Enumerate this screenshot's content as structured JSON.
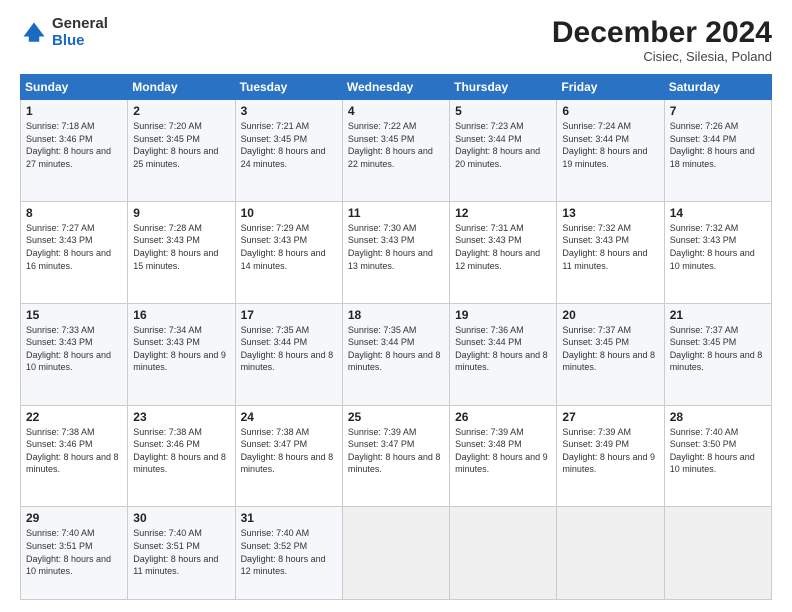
{
  "logo": {
    "general": "General",
    "blue": "Blue"
  },
  "header": {
    "month": "December 2024",
    "location": "Cisiec, Silesia, Poland"
  },
  "weekdays": [
    "Sunday",
    "Monday",
    "Tuesday",
    "Wednesday",
    "Thursday",
    "Friday",
    "Saturday"
  ],
  "weeks": [
    [
      {
        "day": "1",
        "sunrise": "Sunrise: 7:18 AM",
        "sunset": "Sunset: 3:46 PM",
        "daylight": "Daylight: 8 hours and 27 minutes."
      },
      {
        "day": "2",
        "sunrise": "Sunrise: 7:20 AM",
        "sunset": "Sunset: 3:45 PM",
        "daylight": "Daylight: 8 hours and 25 minutes."
      },
      {
        "day": "3",
        "sunrise": "Sunrise: 7:21 AM",
        "sunset": "Sunset: 3:45 PM",
        "daylight": "Daylight: 8 hours and 24 minutes."
      },
      {
        "day": "4",
        "sunrise": "Sunrise: 7:22 AM",
        "sunset": "Sunset: 3:45 PM",
        "daylight": "Daylight: 8 hours and 22 minutes."
      },
      {
        "day": "5",
        "sunrise": "Sunrise: 7:23 AM",
        "sunset": "Sunset: 3:44 PM",
        "daylight": "Daylight: 8 hours and 20 minutes."
      },
      {
        "day": "6",
        "sunrise": "Sunrise: 7:24 AM",
        "sunset": "Sunset: 3:44 PM",
        "daylight": "Daylight: 8 hours and 19 minutes."
      },
      {
        "day": "7",
        "sunrise": "Sunrise: 7:26 AM",
        "sunset": "Sunset: 3:44 PM",
        "daylight": "Daylight: 8 hours and 18 minutes."
      }
    ],
    [
      {
        "day": "8",
        "sunrise": "Sunrise: 7:27 AM",
        "sunset": "Sunset: 3:43 PM",
        "daylight": "Daylight: 8 hours and 16 minutes."
      },
      {
        "day": "9",
        "sunrise": "Sunrise: 7:28 AM",
        "sunset": "Sunset: 3:43 PM",
        "daylight": "Daylight: 8 hours and 15 minutes."
      },
      {
        "day": "10",
        "sunrise": "Sunrise: 7:29 AM",
        "sunset": "Sunset: 3:43 PM",
        "daylight": "Daylight: 8 hours and 14 minutes."
      },
      {
        "day": "11",
        "sunrise": "Sunrise: 7:30 AM",
        "sunset": "Sunset: 3:43 PM",
        "daylight": "Daylight: 8 hours and 13 minutes."
      },
      {
        "day": "12",
        "sunrise": "Sunrise: 7:31 AM",
        "sunset": "Sunset: 3:43 PM",
        "daylight": "Daylight: 8 hours and 12 minutes."
      },
      {
        "day": "13",
        "sunrise": "Sunrise: 7:32 AM",
        "sunset": "Sunset: 3:43 PM",
        "daylight": "Daylight: 8 hours and 11 minutes."
      },
      {
        "day": "14",
        "sunrise": "Sunrise: 7:32 AM",
        "sunset": "Sunset: 3:43 PM",
        "daylight": "Daylight: 8 hours and 10 minutes."
      }
    ],
    [
      {
        "day": "15",
        "sunrise": "Sunrise: 7:33 AM",
        "sunset": "Sunset: 3:43 PM",
        "daylight": "Daylight: 8 hours and 10 minutes."
      },
      {
        "day": "16",
        "sunrise": "Sunrise: 7:34 AM",
        "sunset": "Sunset: 3:43 PM",
        "daylight": "Daylight: 8 hours and 9 minutes."
      },
      {
        "day": "17",
        "sunrise": "Sunrise: 7:35 AM",
        "sunset": "Sunset: 3:44 PM",
        "daylight": "Daylight: 8 hours and 8 minutes."
      },
      {
        "day": "18",
        "sunrise": "Sunrise: 7:35 AM",
        "sunset": "Sunset: 3:44 PM",
        "daylight": "Daylight: 8 hours and 8 minutes."
      },
      {
        "day": "19",
        "sunrise": "Sunrise: 7:36 AM",
        "sunset": "Sunset: 3:44 PM",
        "daylight": "Daylight: 8 hours and 8 minutes."
      },
      {
        "day": "20",
        "sunrise": "Sunrise: 7:37 AM",
        "sunset": "Sunset: 3:45 PM",
        "daylight": "Daylight: 8 hours and 8 minutes."
      },
      {
        "day": "21",
        "sunrise": "Sunrise: 7:37 AM",
        "sunset": "Sunset: 3:45 PM",
        "daylight": "Daylight: 8 hours and 8 minutes."
      }
    ],
    [
      {
        "day": "22",
        "sunrise": "Sunrise: 7:38 AM",
        "sunset": "Sunset: 3:46 PM",
        "daylight": "Daylight: 8 hours and 8 minutes."
      },
      {
        "day": "23",
        "sunrise": "Sunrise: 7:38 AM",
        "sunset": "Sunset: 3:46 PM",
        "daylight": "Daylight: 8 hours and 8 minutes."
      },
      {
        "day": "24",
        "sunrise": "Sunrise: 7:38 AM",
        "sunset": "Sunset: 3:47 PM",
        "daylight": "Daylight: 8 hours and 8 minutes."
      },
      {
        "day": "25",
        "sunrise": "Sunrise: 7:39 AM",
        "sunset": "Sunset: 3:47 PM",
        "daylight": "Daylight: 8 hours and 8 minutes."
      },
      {
        "day": "26",
        "sunrise": "Sunrise: 7:39 AM",
        "sunset": "Sunset: 3:48 PM",
        "daylight": "Daylight: 8 hours and 9 minutes."
      },
      {
        "day": "27",
        "sunrise": "Sunrise: 7:39 AM",
        "sunset": "Sunset: 3:49 PM",
        "daylight": "Daylight: 8 hours and 9 minutes."
      },
      {
        "day": "28",
        "sunrise": "Sunrise: 7:40 AM",
        "sunset": "Sunset: 3:50 PM",
        "daylight": "Daylight: 8 hours and 10 minutes."
      }
    ],
    [
      {
        "day": "29",
        "sunrise": "Sunrise: 7:40 AM",
        "sunset": "Sunset: 3:51 PM",
        "daylight": "Daylight: 8 hours and 10 minutes."
      },
      {
        "day": "30",
        "sunrise": "Sunrise: 7:40 AM",
        "sunset": "Sunset: 3:51 PM",
        "daylight": "Daylight: 8 hours and 11 minutes."
      },
      {
        "day": "31",
        "sunrise": "Sunrise: 7:40 AM",
        "sunset": "Sunset: 3:52 PM",
        "daylight": "Daylight: 8 hours and 12 minutes."
      },
      null,
      null,
      null,
      null
    ]
  ]
}
